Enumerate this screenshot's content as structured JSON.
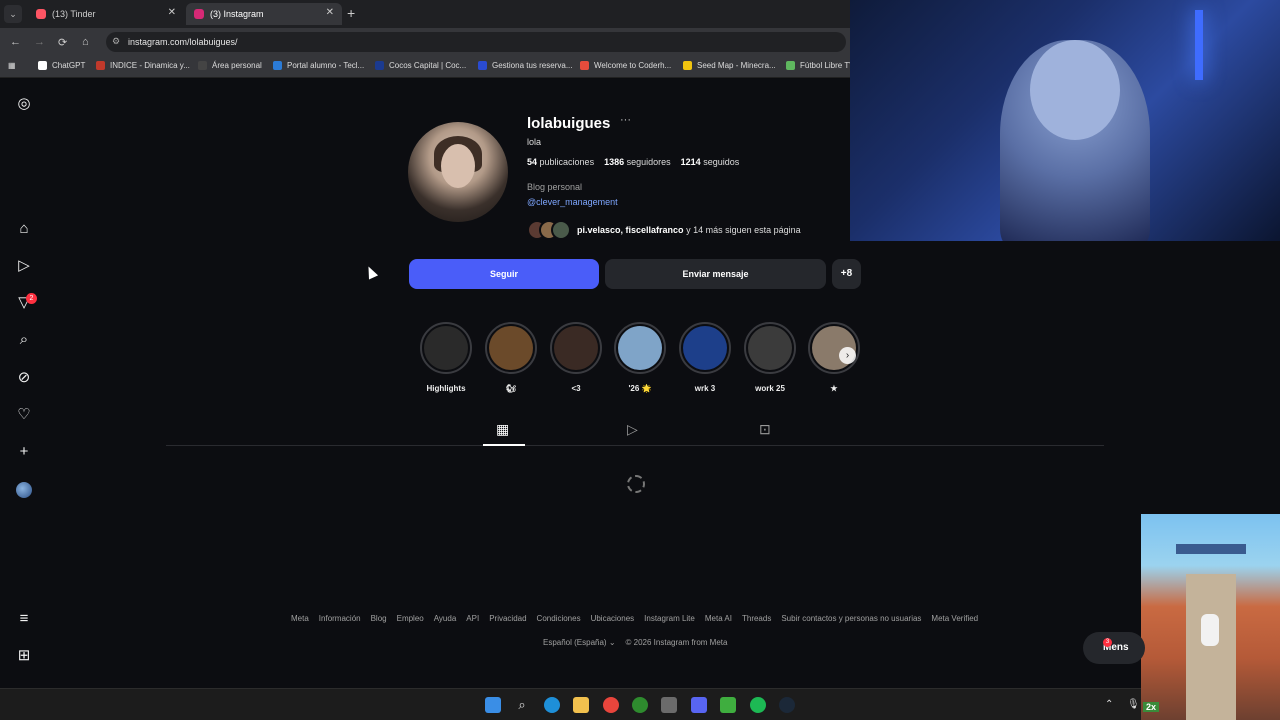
{
  "browser": {
    "tabs": [
      {
        "title": "(13) Tinder",
        "color": "#fd5564",
        "active": false
      },
      {
        "title": "(3) Instagram",
        "color": "#d62976",
        "active": true
      }
    ],
    "url": "instagram.com/lolabuigues/",
    "bookmarks": [
      {
        "label": "ChatGPT",
        "color": "#ffffff"
      },
      {
        "label": "INDICE - Dinamica y...",
        "color": "#c0392b"
      },
      {
        "label": "Área personal",
        "color": "#444444"
      },
      {
        "label": "Portal alumno - Tecl...",
        "color": "#2b7bd6"
      },
      {
        "label": "Cocos Capital | Coc...",
        "color": "#1b3a8f"
      },
      {
        "label": "Gestiona tus reserva...",
        "color": "#2a4bd1"
      },
      {
        "label": "Welcome to Coderh...",
        "color": "#e74c3c"
      },
      {
        "label": "Seed Map - Minecra...",
        "color": "#f1c40f"
      },
      {
        "label": "Fútbol Libre TV",
        "color": "#5fb75f"
      }
    ]
  },
  "sidenav": {
    "icons": [
      "instagram-icon",
      "home-icon",
      "reels-icon",
      "messages-icon",
      "search-icon",
      "explore-icon",
      "notifications-icon",
      "create-icon"
    ],
    "messages_badge": "2"
  },
  "profile": {
    "username": "lolabuigues",
    "more": "···",
    "full_name": "lola",
    "stats": [
      {
        "value": "54",
        "label": "publicaciones"
      },
      {
        "value": "1386",
        "label": "seguidores"
      },
      {
        "value": "1214",
        "label": "seguidos"
      }
    ],
    "category": "Blog personal",
    "link": "@clever_management",
    "followed_by_names": "pi.velasco, fiscellafranco",
    "followed_by_rest": " y 14 más siguen esta página",
    "follow_label": "Seguir",
    "message_label": "Enviar mensaje",
    "suggest_icon": "+8"
  },
  "highlights": [
    {
      "label": "Highlights",
      "color": "#2a2a2a"
    },
    {
      "label": "🐿",
      "color": "#6b4a2a"
    },
    {
      "label": "<3",
      "color": "#3a2a24"
    },
    {
      "label": "'26 🌟",
      "color": "#7fa4c8"
    },
    {
      "label": "wrk 3",
      "color": "#1d3f8a"
    },
    {
      "label": "work 25",
      "color": "#3b3b3b"
    },
    {
      "label": "★",
      "color": "#8a7a6a"
    }
  ],
  "tabs": [
    "posts-grid",
    "reels",
    "tagged"
  ],
  "footer": {
    "links": [
      "Meta",
      "Información",
      "Blog",
      "Empleo",
      "Ayuda",
      "API",
      "Privacidad",
      "Condiciones",
      "Ubicaciones",
      "Instagram Lite",
      "Meta AI",
      "Threads",
      "Subir contactos y personas no usuarias",
      "Meta Verified"
    ],
    "language": "Español (España)",
    "copyright": "© 2026 Instagram from Meta"
  },
  "messages_pill": {
    "label": "Mens",
    "badge": "3"
  },
  "game": {
    "multiplier": "2x"
  }
}
